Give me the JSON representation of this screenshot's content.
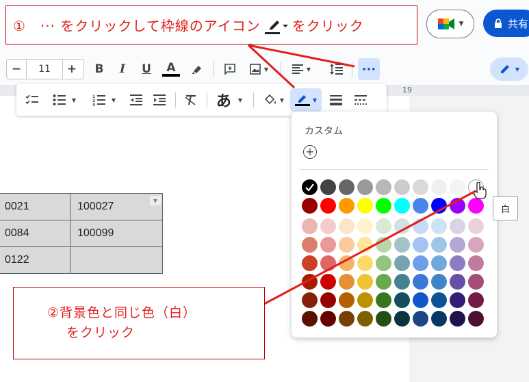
{
  "header": {
    "share_label": "共有",
    "lock_icon": "lock-icon",
    "meet_icon": "meet-icon"
  },
  "toolbar": {
    "font_size": "11",
    "minus_label": "−",
    "plus_label": "+",
    "bold_label": "B",
    "italic_label": "I",
    "underline_label": "U",
    "text_color_label": "A",
    "more_label": "···"
  },
  "ruler": {
    "mark": "19"
  },
  "table": {
    "rows": [
      [
        "0021",
        "100027"
      ],
      [
        "0084",
        "100099"
      ],
      [
        "0122",
        ""
      ]
    ]
  },
  "palette": {
    "custom_label": "カスタム",
    "add_label": "+",
    "selected_color": "#000000",
    "hovered_color": "#ffffff",
    "rows": [
      [
        "#000000",
        "#434343",
        "#666666",
        "#999999",
        "#b7b7b7",
        "#cccccc",
        "#d9d9d9",
        "#efefef",
        "#f3f3f3",
        "#ffffff"
      ],
      [
        "#980000",
        "#ff0000",
        "#ff9900",
        "#ffff00",
        "#00ff00",
        "#00ffff",
        "#4a86e8",
        "#0000ff",
        "#9900ff",
        "#ff00ff"
      ],
      [
        "#e6b8af",
        "#f4cccc",
        "#fce5cd",
        "#fff2cc",
        "#d9ead3",
        "#d0e0e3",
        "#c9daf8",
        "#cfe2f3",
        "#d9d2e9",
        "#ead1dc"
      ],
      [
        "#dd7e6b",
        "#ea9999",
        "#f9cb9c",
        "#ffe599",
        "#b6d7a8",
        "#a2c4c9",
        "#a4c2f4",
        "#9fc5e8",
        "#b4a7d6",
        "#d5a6bd"
      ],
      [
        "#cc4125",
        "#e06666",
        "#f6b26b",
        "#ffd966",
        "#93c47d",
        "#76a5af",
        "#6d9eeb",
        "#6fa8dc",
        "#8e7cc3",
        "#c27ba0"
      ],
      [
        "#a61c00",
        "#cc0000",
        "#e69138",
        "#f1c232",
        "#6aa84f",
        "#45818e",
        "#3c78d8",
        "#3d85c6",
        "#674ea7",
        "#a64d79"
      ],
      [
        "#85200c",
        "#990000",
        "#b45f06",
        "#bf9000",
        "#38761d",
        "#134f5c",
        "#1155cc",
        "#0b5394",
        "#351c75",
        "#741b47"
      ],
      [
        "#5b0f00",
        "#660000",
        "#783f04",
        "#7f6000",
        "#274e13",
        "#0c343d",
        "#1c4587",
        "#073763",
        "#20124d",
        "#4c1130"
      ]
    ]
  },
  "tooltip": {
    "text": "白"
  },
  "callouts": {
    "step1_text": "①　··· をクリックして枠線のアイコン",
    "step1_suffix": "をクリック",
    "step2_line1": "②背景色と同じ色（白）",
    "step2_line2": "をクリック"
  },
  "colors": {
    "annotation_red": "#e0201c",
    "share_blue": "#0b57d0",
    "active_blue": "#c2e7ff"
  }
}
